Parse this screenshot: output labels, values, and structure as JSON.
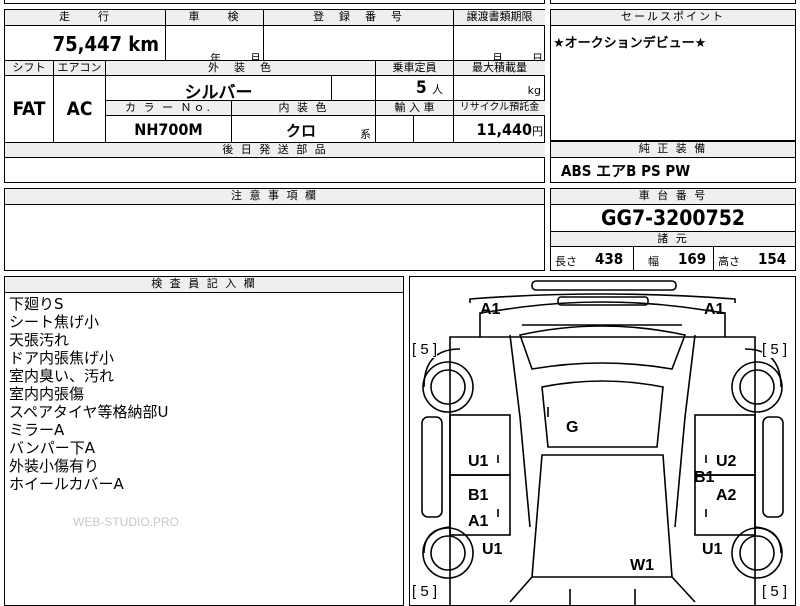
{
  "top": {
    "headers": {
      "mileage": "走　　行",
      "inspection": "車　　検",
      "registration": "登　録　番　号",
      "transfer_deadline": "譲渡書類期限",
      "sales_point": "セールスポイント"
    },
    "mileage_value": "75,447",
    "mileage_unit": "km",
    "inspection_year": "年",
    "inspection_month": "月",
    "transfer_month": "月",
    "transfer_day": "日",
    "sales_point_text": "★オークションデビュー★"
  },
  "spec": {
    "headers": {
      "shift": "シフト",
      "aircon": "エアコン",
      "exterior_color": "外　装　色",
      "capacity": "乗車定員",
      "max_load": "最大積載量",
      "color_no": "カ ラ ー Ｎｏ.",
      "interior_color": "内 装 色",
      "import": "輸 入 車",
      "recycle": "リサイクル預託金",
      "later_parts": "後 日 発 送 部 品"
    },
    "shift_value": "FAT",
    "aircon_value": "AC",
    "exterior_color_value": "シルバー",
    "capacity_value": "5",
    "capacity_unit": "人",
    "max_load_unit": "kg",
    "color_no_value": "NH700M",
    "interior_color_value": "クロ",
    "interior_suffix": "系",
    "recycle_value": "11,440",
    "recycle_unit": "円"
  },
  "equipment": {
    "header": "純 正 装 備",
    "value": "ABS エアB PS PW"
  },
  "caution": {
    "header": "注 意 事 項 欄"
  },
  "chassis": {
    "header": "車 台 番 号",
    "value": "GG7-3200752",
    "dims_header": "諸 元",
    "length_label": "長さ",
    "length_value": "438",
    "width_label": "幅",
    "width_value": "169",
    "height_label": "高さ",
    "height_value": "154"
  },
  "inspector": {
    "header": "検 査 員 記 入 欄",
    "notes": [
      "下廻りS",
      "シート焦げ小",
      "天張汚れ",
      "ドア内張焦げ小",
      "室内臭い、汚れ",
      "室内内張傷",
      "スペアタイヤ等格納部U",
      "ミラーA",
      "バンパー下A",
      "外装小傷有り",
      "ホイールカバーA"
    ]
  },
  "watermark": "WEB-STUDIO.PRO",
  "diagram": {
    "marks": {
      "front_left": "A1",
      "front_right": "A1",
      "roof": "G",
      "left_door_front": "U1",
      "left_door_rear_top": "B1",
      "left_door_rear_bottom": "A1",
      "right_door_front": "U2",
      "right_door_rear_small": "B1",
      "right_door_rear": "A2",
      "left_rear_wheel": "U1",
      "right_rear_wheel": "U1",
      "rear_glass": "W1"
    },
    "tire_marks": {
      "front_left": "[ 5 ]",
      "front_right": "[ 5 ]",
      "rear_left": "[ 5 ]",
      "rear_right": "[ 5 ]"
    }
  }
}
